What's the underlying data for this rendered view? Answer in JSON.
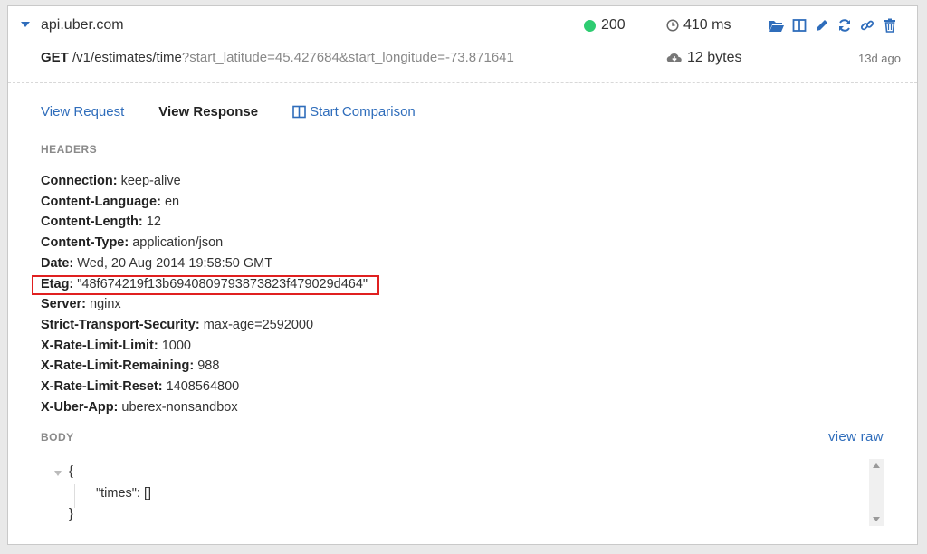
{
  "request": {
    "host": "api.uber.com",
    "method": "GET",
    "path": "/v1/estimates/time",
    "query": "?start_latitude=45.427684&start_longitude=-73.871641",
    "status_code": "200",
    "status_color": "#2ecc71",
    "duration": "410 ms",
    "size": "12 bytes",
    "age": "13d ago"
  },
  "actions": [
    {
      "icon": "folder-open-icon"
    },
    {
      "icon": "columns-icon"
    },
    {
      "icon": "pencil-icon"
    },
    {
      "icon": "refresh-icon"
    },
    {
      "icon": "link-icon"
    },
    {
      "icon": "trash-icon"
    }
  ],
  "tabs": {
    "view_request": "View Request",
    "view_response": "View Response",
    "start_comparison": "Start Comparison"
  },
  "headers_title": "HEADERS",
  "headers": [
    {
      "name": "Connection:",
      "value": "keep-alive"
    },
    {
      "name": "Content-Language:",
      "value": "en"
    },
    {
      "name": "Content-Length:",
      "value": "12"
    },
    {
      "name": "Content-Type:",
      "value": "application/json"
    },
    {
      "name": "Date:",
      "value": "Wed, 20 Aug 2014 19:58:50 GMT"
    },
    {
      "name": "Etag:",
      "value": "\"48f674219f13b6940809793873823f479029d464\""
    },
    {
      "name": "Server:",
      "value": "nginx"
    },
    {
      "name": "Strict-Transport-Security:",
      "value": "max-age=2592000"
    },
    {
      "name": "X-Rate-Limit-Limit:",
      "value": "1000"
    },
    {
      "name": "X-Rate-Limit-Remaining:",
      "value": "988"
    },
    {
      "name": "X-Rate-Limit-Reset:",
      "value": "1408564800"
    },
    {
      "name": "X-Uber-App:",
      "value": "uberex-nonsandbox"
    }
  ],
  "body_title": "BODY",
  "view_raw": "view raw",
  "body": {
    "open": "{",
    "line": "\"times\": []",
    "close": "}"
  },
  "colors": {
    "accent": "#2f6dbb",
    "highlight": "#e02020"
  }
}
